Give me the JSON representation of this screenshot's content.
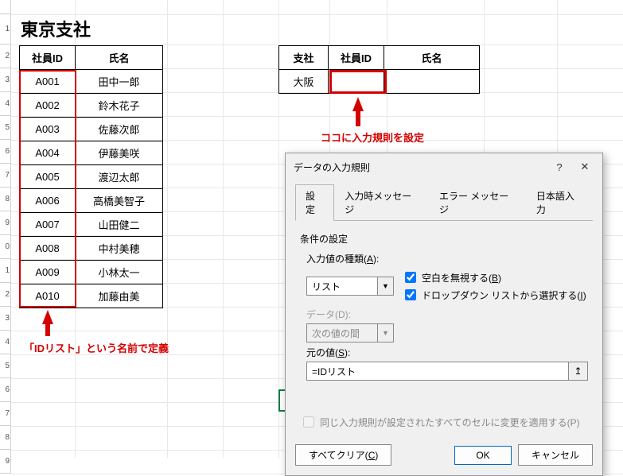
{
  "sheet_title": "東京支社",
  "table1": {
    "headers": [
      "社員ID",
      "氏名"
    ],
    "rows": [
      [
        "A001",
        "田中一郎"
      ],
      [
        "A002",
        "鈴木花子"
      ],
      [
        "A003",
        "佐藤次郎"
      ],
      [
        "A004",
        "伊藤美咲"
      ],
      [
        "A005",
        "渡辺太郎"
      ],
      [
        "A006",
        "高橋美智子"
      ],
      [
        "A007",
        "山田健二"
      ],
      [
        "A008",
        "中村美穂"
      ],
      [
        "A009",
        "小林太一"
      ],
      [
        "A010",
        "加藤由美"
      ]
    ]
  },
  "table2": {
    "headers": [
      "支社",
      "社員ID",
      "氏名"
    ],
    "rows": [
      [
        "大阪",
        "",
        ""
      ]
    ]
  },
  "annotations": {
    "idlist_label": "「IDリスト」という名前で定義",
    "target_label": "ココに入力規則を設定"
  },
  "dialog": {
    "title": "データの入力規則",
    "tabs": [
      "設定",
      "入力時メッセージ",
      "エラー メッセージ",
      "日本語入力"
    ],
    "active_tab": 0,
    "group": "条件の設定",
    "allow_label": "入力値の種類(A):",
    "allow_value": "リスト",
    "data_label": "データ(D):",
    "data_value": "次の値の間",
    "ignore_blank_label": "空白を無視する(B)",
    "ignore_blank_checked": true,
    "dropdown_label": "ドロップダウン リストから選択する(I)",
    "dropdown_checked": true,
    "source_label": "元の値(S):",
    "source_value": "=IDリスト",
    "apply_all_label": "同じ入力規則が設定されたすべてのセルに変更を適用する(P)",
    "apply_all_checked": false,
    "clear_btn": "すべてクリア(C)",
    "ok_btn": "OK",
    "cancel_btn": "キャンセル"
  },
  "row_numbers": [
    1,
    2,
    3,
    4,
    5,
    6,
    7,
    8,
    9,
    0,
    1,
    2,
    3,
    4,
    5,
    6,
    7,
    8,
    9
  ]
}
